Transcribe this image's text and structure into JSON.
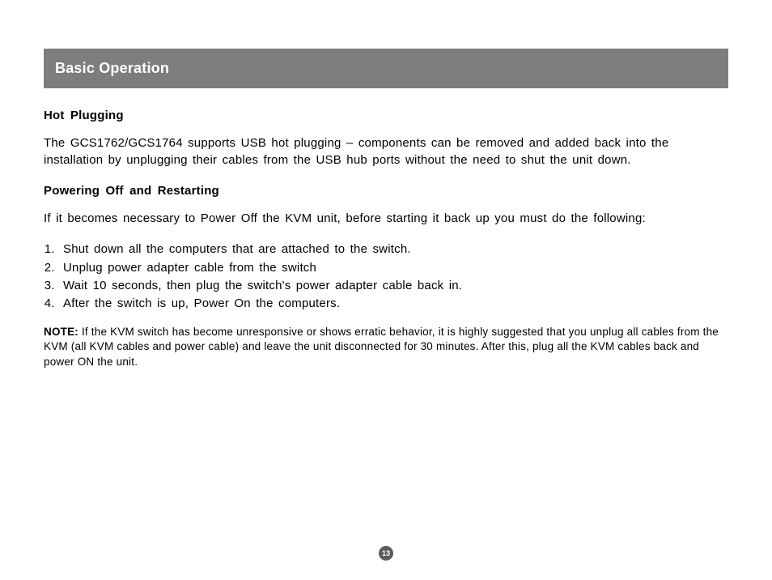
{
  "section_title": "Basic Operation",
  "hot_plugging": {
    "heading": "Hot Plugging",
    "text": "The GCS1762/GCS1764 supports USB hot plugging – components can be removed and added back into the installation by unplugging their cables from the USB hub ports without the need to shut the unit down."
  },
  "powering_off": {
    "heading": "Powering Off and Restarting",
    "intro": "If it becomes necessary to Power Off the KVM unit, before starting it back up you must do the following:",
    "steps": [
      "Shut down all the computers that are attached to the switch.",
      "Unplug power adapter cable from the switch",
      "Wait 10 seconds, then plug the switch's power adapter cable back in.",
      "After the switch is up, Power On the computers."
    ]
  },
  "note": {
    "label": "NOTE:",
    "text": " If the KVM switch has become unresponsive or shows erratic behavior, it is highly suggested that you unplug all cables from the KVM (all KVM cables and power cable) and leave the unit disconnected for 30 minutes.  After this, plug all the KVM cables back and power ON the unit."
  },
  "page_number": "13"
}
